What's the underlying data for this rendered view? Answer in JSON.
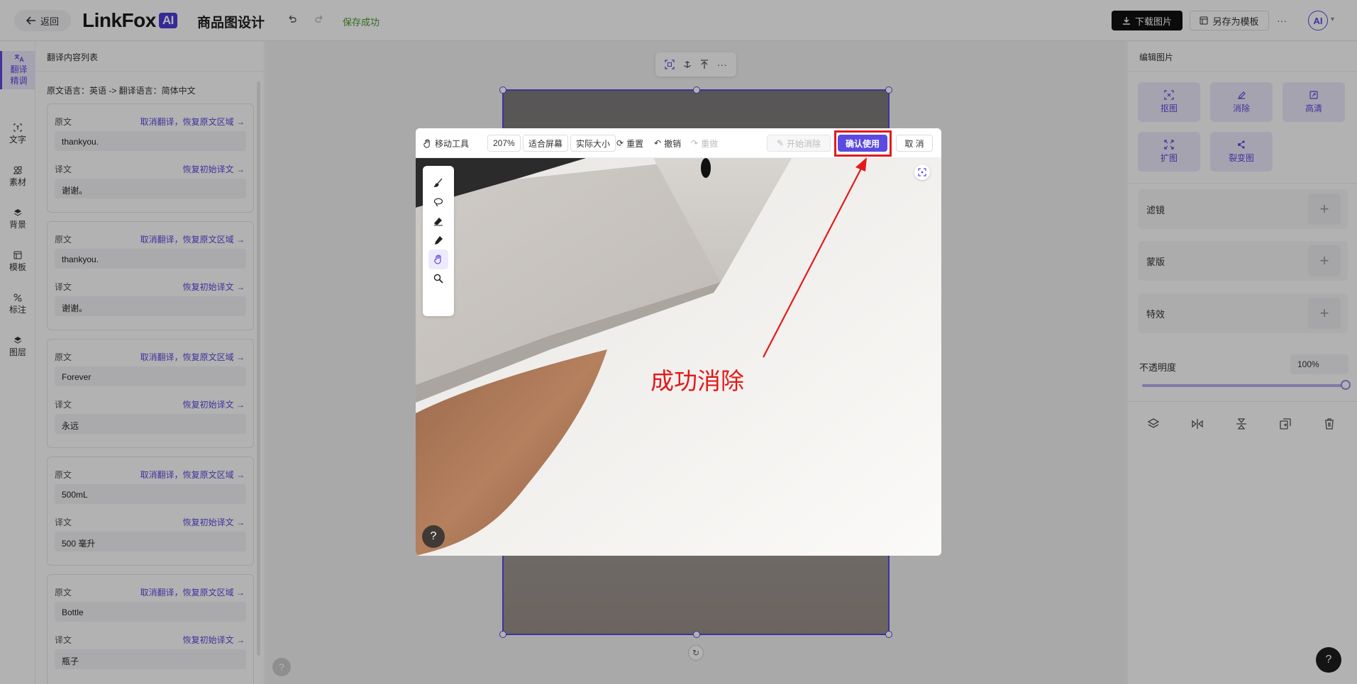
{
  "header": {
    "back_label": "返回",
    "logo_text": "LinkFox",
    "logo_badge": "AI",
    "app_title": "商品图设计",
    "save_status": "保存成功",
    "download_label": "下载图片",
    "save_template_label": "另存为模板",
    "more_label": "···",
    "avatar_text": "AI"
  },
  "left_nav": {
    "items": [
      {
        "label": "翻译精调",
        "icon": "translate-icon",
        "active": true
      },
      {
        "label": "文字",
        "icon": "text-icon"
      },
      {
        "label": "素材",
        "icon": "material-icon"
      },
      {
        "label": "背景",
        "icon": "background-icon"
      },
      {
        "label": "模板",
        "icon": "template-icon"
      },
      {
        "label": "标注",
        "icon": "annotate-icon"
      },
      {
        "label": "图层",
        "icon": "layers-icon"
      }
    ]
  },
  "translation_panel": {
    "title": "翻译内容列表",
    "language_line": "原文语言：英语 -> 翻译语言：简体中文",
    "source_label": "原文",
    "target_label": "译文",
    "cancel_action": "取消翻译，恢复原文区域 →",
    "restore_action": "恢复初始译文 →",
    "items": [
      {
        "source": "thankyou.",
        "target": "谢谢。"
      },
      {
        "source": "thankyou.",
        "target": "谢谢。"
      },
      {
        "source": "Forever",
        "target": "永远"
      },
      {
        "source": "500mL",
        "target": "500 毫升"
      },
      {
        "source": "Bottle",
        "target": "瓶子"
      }
    ]
  },
  "right_panel": {
    "title": "编辑图片",
    "tools": [
      {
        "label": "抠图",
        "icon": "cutout-icon"
      },
      {
        "label": "消除",
        "icon": "erase-icon"
      },
      {
        "label": "高清",
        "icon": "hd-icon"
      },
      {
        "label": "扩图",
        "icon": "expand-icon"
      },
      {
        "label": "裂变图",
        "icon": "fission-icon"
      }
    ],
    "sections": [
      "滤镜",
      "蒙版",
      "特效"
    ],
    "opacity_label": "不透明度",
    "opacity_value": "100%",
    "opacity_fraction": 1.0
  },
  "modal": {
    "move_tool_label": "移动工具",
    "zoom": "207%",
    "fit_screen": "适合屏幕",
    "actual_size": "实际大小",
    "reset": "重置",
    "undo": "撤销",
    "redo": "重做",
    "start_erase": "开始消除",
    "confirm": "确认使用",
    "cancel": "取 消",
    "help": "?"
  },
  "annotation": {
    "text": "成功消除",
    "color": "#e21a1a"
  },
  "colors": {
    "accent": "#5b4ae0",
    "dark_button": "#111111",
    "saved_green": "#4a9a2e"
  }
}
